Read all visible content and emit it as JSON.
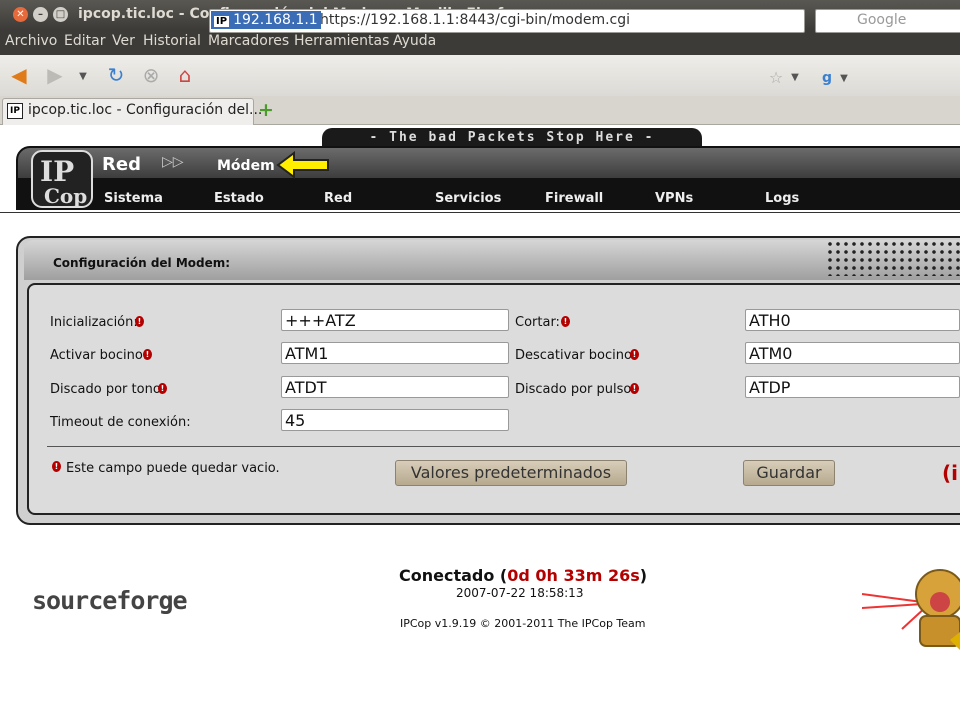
{
  "window": {
    "title": "ipcop.tic.loc - Configuración del Modem - Mozilla Firefox"
  },
  "menubar": [
    "Archivo",
    "Editar",
    "Ver",
    "Historial",
    "Marcadores",
    "Herramientas",
    "Ayuda"
  ],
  "navbar": {
    "site_badge": "192.168.1.1",
    "url": "https://192.168.1.1:8443/cgi-bin/modem.cgi",
    "search_placeholder": "Google"
  },
  "tab": {
    "title": "ipcop.tic.loc - Configuración del..."
  },
  "ipcop": {
    "banner": "- The bad Packets Stop Here -",
    "section": "Red",
    "page": "Módem",
    "nav": [
      "Sistema",
      "Estado",
      "Red",
      "Servicios",
      "Firewall",
      "VPNs",
      "Logs"
    ]
  },
  "panel": {
    "title": "Configuración del Modem:",
    "fields": {
      "inicializacion": {
        "label": "Inicialización:",
        "value": "+++ATZ"
      },
      "cortar": {
        "label": "Cortar:",
        "value": "ATH0"
      },
      "activar_bocino": {
        "label": "Activar bocino:",
        "value": "ATM1"
      },
      "descativar_bocino": {
        "label": "Descativar bocino:",
        "value": "ATM0"
      },
      "discado_tono": {
        "label": "Discado por tono:",
        "value": "ATDT"
      },
      "discado_pulso": {
        "label": "Discado por pulso:",
        "value": "ATDP"
      },
      "timeout": {
        "label": "Timeout de conexión:",
        "value": "45"
      }
    },
    "note": "Este campo puede quedar vacio.",
    "buttons": {
      "defaults": "Valores predeterminados",
      "save": "Guardar"
    }
  },
  "footer": {
    "sf_logo": "sourceforge",
    "connected_label": "Conectado",
    "connected_time": "0d 0h 33m 26s",
    "datetime": "2007-07-22  18:58:13",
    "copyright": "IPCop v1.9.19 © 2001-2011 The IPCop Team"
  },
  "colors": {
    "accent_red": "#b30000",
    "header_dark": "#111111",
    "button": "#c8bca4"
  }
}
